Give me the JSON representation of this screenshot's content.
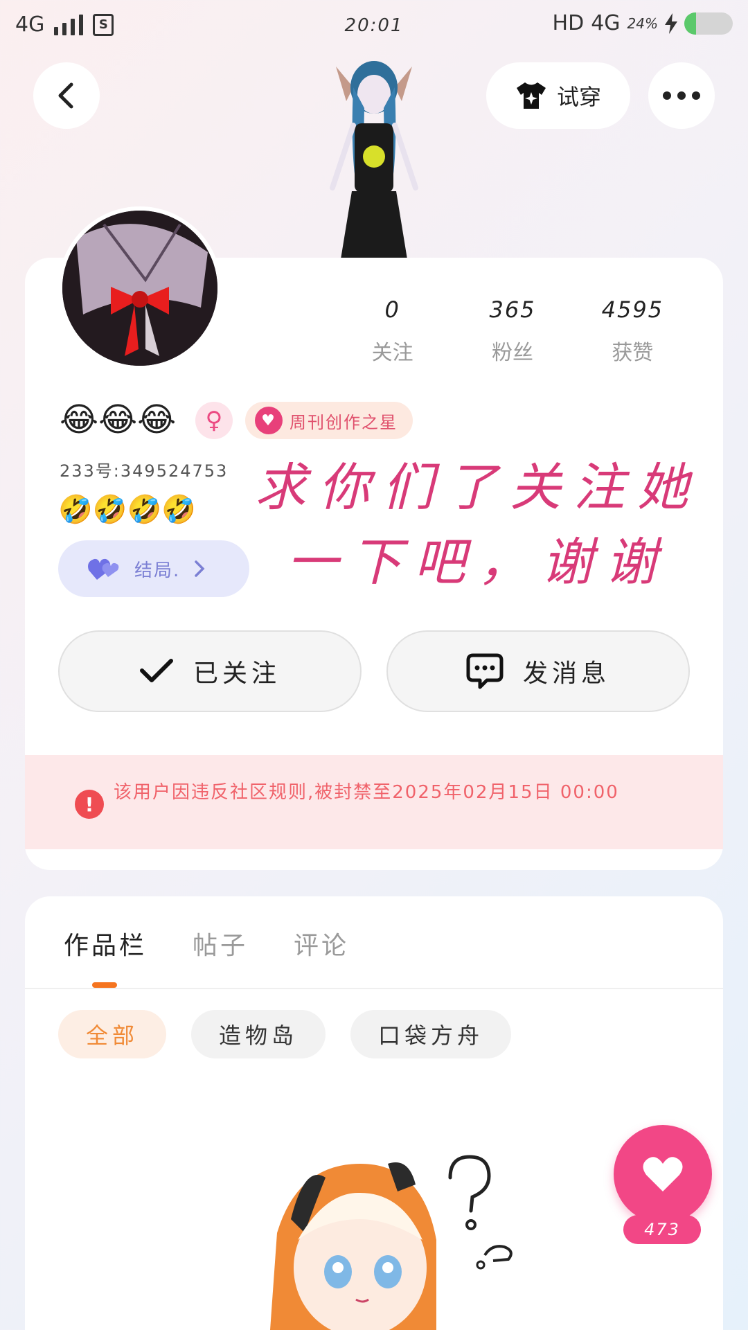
{
  "status_bar": {
    "network_left": "4G",
    "sim_label": "S",
    "time": "20:01",
    "hd": "HD",
    "network_right": "4G",
    "battery": "24%",
    "battery_level": 0.24
  },
  "header": {
    "back_icon": "chevron-left-icon",
    "try_on_label": "试穿",
    "try_on_icon": "tshirt-sparkle-icon",
    "more_icon": "more-dots-icon"
  },
  "profile": {
    "stats": [
      {
        "value": "0",
        "label": "关注"
      },
      {
        "value": "365",
        "label": "粉丝"
      },
      {
        "value": "4595",
        "label": "获赞"
      }
    ],
    "emoji_name": "😂😂😂",
    "gender_symbol": "♀",
    "badge_text": "周刊创作之星",
    "uid": "233号:349524753",
    "signature_emoji": "🤣🤣🤣🤣",
    "ending_label": "结局.",
    "overlay_text_line1": "求你们了关注她",
    "overlay_text_line2": "一下吧，谢谢",
    "follow_label": "已关注",
    "message_label": "发消息",
    "ban_notice": "该用户因违反社区规则,被封禁至2025年02月15日 00:00"
  },
  "works": {
    "tabs": [
      {
        "label": "作品栏",
        "active": true
      },
      {
        "label": "帖子",
        "active": false
      },
      {
        "label": "评论",
        "active": false
      }
    ],
    "chips": [
      {
        "label": "全部",
        "active": true
      },
      {
        "label": "造物岛",
        "active": false
      },
      {
        "label": "口袋方舟",
        "active": false
      }
    ]
  },
  "like_fab": {
    "count": "473",
    "icon": "heart-icon"
  },
  "colors": {
    "accent_pink": "#f24786",
    "tab_indicator": "#f5741f",
    "ban_text": "#f0626a",
    "overlay_text": "#d83a78"
  }
}
